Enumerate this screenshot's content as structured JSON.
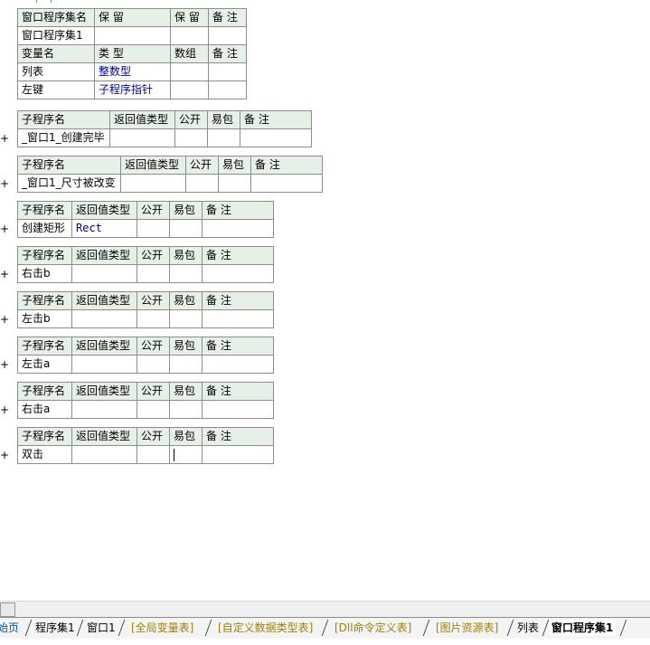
{
  "module_table": {
    "header": [
      "窗口程序集名",
      "保 留",
      "保 留",
      "备 注"
    ],
    "row": [
      "窗口程序集1",
      "",
      "",
      ""
    ],
    "var_header": [
      "变量名",
      "类 型",
      "数组",
      "备 注"
    ],
    "vars": [
      [
        "列表",
        "整数型",
        "",
        ""
      ],
      [
        "左键",
        "子程序指针",
        "",
        ""
      ]
    ]
  },
  "sub_header": [
    "子程序名",
    "返回值类型",
    "公开",
    "易包",
    "备 注"
  ],
  "subs": [
    {
      "name": "_窗口1_创建完毕",
      "ret": ""
    },
    {
      "name": "_窗口1_尺寸被改变",
      "ret": ""
    },
    {
      "name": "创建矩形",
      "ret": "Rect"
    },
    {
      "name": "右击b",
      "ret": ""
    },
    {
      "name": "左击b",
      "ret": ""
    },
    {
      "name": "左击a",
      "ret": ""
    },
    {
      "name": "右击a",
      "ret": ""
    },
    {
      "name": "双击",
      "ret": ""
    }
  ],
  "expand_glyph": "+",
  "tabs": [
    {
      "label": "始页",
      "style": "blue"
    },
    {
      "label": "程序集1",
      "style": "normal"
    },
    {
      "label": "窗口1",
      "style": "normal"
    },
    {
      "label": "[全局变量表]",
      "style": "gold"
    },
    {
      "label": "[自定义数据类型表]",
      "style": "gold"
    },
    {
      "label": "[Dll命令定义表]",
      "style": "gold"
    },
    {
      "label": "[图片资源表]",
      "style": "gold"
    },
    {
      "label": "列表",
      "style": "normal"
    },
    {
      "label": "窗口程序集1",
      "style": "active"
    }
  ]
}
